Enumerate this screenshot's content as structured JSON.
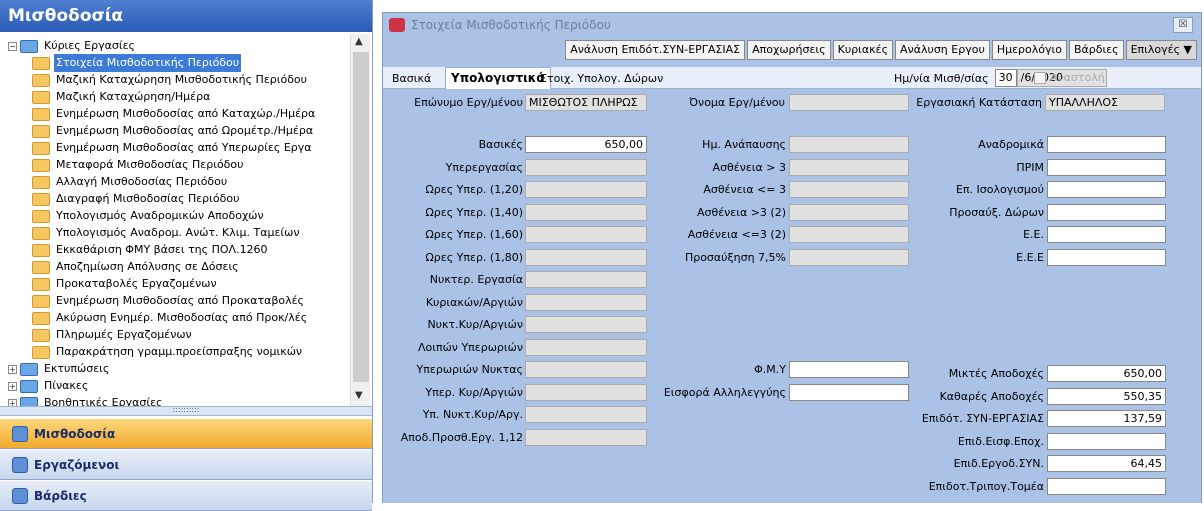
{
  "nav": {
    "title": "Μισθοδοσία",
    "tree": [
      {
        "label": "Κύριες Εργασίες",
        "level": 0,
        "expander": "−",
        "blue": true
      },
      {
        "label": "Στοιχεία Μισθοδοτικής Περιόδου",
        "level": 1,
        "selected": true
      },
      {
        "label": "Μαζική Καταχώρηση Μισθοδοτικής Περιόδου",
        "level": 1
      },
      {
        "label": "Μαζική Καταχώρηση/Ημέρα",
        "level": 1
      },
      {
        "label": "Ενημέρωση Μισθοδοσίας από Καταχώρ./Ημέρα",
        "level": 1
      },
      {
        "label": "Ενημέρωση Μισθοδοσίας από Ωρομέτρ./Ημέρα",
        "level": 1
      },
      {
        "label": "Ενημέρωση Μισθοδοσίας από Υπερωρίες Εργα",
        "level": 1
      },
      {
        "label": "Μεταφορά Μισθοδοσίας Περιόδου",
        "level": 1
      },
      {
        "label": "Αλλαγή Μισθοδοσίας Περιόδου",
        "level": 1
      },
      {
        "label": "Διαγραφή Μισθοδοσίας Περιόδου",
        "level": 1
      },
      {
        "label": "Υπολογισμός Αναδρομικών Αποδοχών",
        "level": 1
      },
      {
        "label": "Υπολογισμός Αναδρομ. Ανώτ. Κλιμ. Ταμείων",
        "level": 1
      },
      {
        "label": "Εκκαθάριση ΦΜΥ βάσει της ΠΟΛ.1260",
        "level": 1
      },
      {
        "label": "Αποζημίωση Απόλυσης σε Δόσεις",
        "level": 1
      },
      {
        "label": "Προκαταβολές Εργαζομένων",
        "level": 1
      },
      {
        "label": "Ενημέρωση Μισθοδοσίας από Προκαταβολές",
        "level": 1
      },
      {
        "label": "Ακύρωση Ενημέρ. Μισθοδοσίας από Προκ/λές",
        "level": 1
      },
      {
        "label": "Πληρωμές Εργαζομένων",
        "level": 1
      },
      {
        "label": "Παρακράτηση γραμμ.προείσπραξης νομικών",
        "level": 1
      },
      {
        "label": "Εκτυπώσεις",
        "level": 0,
        "expander": "+",
        "blue": true
      },
      {
        "label": "Πίνακες",
        "level": 0,
        "expander": "+",
        "blue": true
      },
      {
        "label": "Βοηθητικές Εργασίες",
        "level": 0,
        "expander": "+",
        "blue": true
      }
    ],
    "splitter_dots": "::::::::::",
    "buttons": [
      {
        "label": "Μισθοδοσία",
        "active": true
      },
      {
        "label": "Εργαζόμενοι",
        "active": false
      },
      {
        "label": "Βάρδιες",
        "active": false
      }
    ]
  },
  "window": {
    "title": "Στοιχεία Μισθοδοτικής Περιόδου",
    "close": "☒",
    "toolbar": [
      "Ανάλυση Επιδότ.ΣΥΝ-ΕΡΓΑΣΙΑΣ",
      "Αποχωρήσεις",
      "Κυριακές",
      "Ανάλυση Εργου",
      "Ημερολόγιο",
      "Βάρδιες",
      "Επιλογές ▼"
    ],
    "tabs": [
      "Βασικά",
      "Υπολογιστικά",
      "Στοιχ. Υπολογ. Δώρων"
    ],
    "active_tab": "Υπολογιστικά",
    "date_label": "Ημ/νία Μισθ/σίας",
    "date_day": "30",
    "date_rest": "/6/2020",
    "suspend_label": "Αναστολή"
  },
  "form": {
    "employee_label": "Επώνυμο Εργ/μένου",
    "employee_value": "ΜΙΣΘΩΤΟΣ ΠΛΗΡΩΣ",
    "first_name_label": "Όνομα Εργ/μένου",
    "first_name_value": "",
    "status_label": "Εργασιακή Κατάσταση",
    "status_value": "ΥΠΑΛΛΗΛΟΣ",
    "col1": [
      {
        "label": "Βασικές",
        "value": "650,00"
      },
      {
        "label": "Υπερεργασίας",
        "value": ""
      },
      {
        "label": "Ωρες Υπερ. (1,20)",
        "value": ""
      },
      {
        "label": "Ωρες Υπερ. (1,40)",
        "value": ""
      },
      {
        "label": "Ωρες Υπερ. (1,60)",
        "value": ""
      },
      {
        "label": "Ωρες Υπερ. (1,80)",
        "value": ""
      },
      {
        "label": "Νυκτερ. Εργασία",
        "value": ""
      },
      {
        "label": "Κυριακών/Αργιών",
        "value": ""
      },
      {
        "label": "Νυκτ.Κυρ/Αργιών",
        "value": ""
      },
      {
        "label": "Λοιπών Υπερωριών",
        "value": ""
      },
      {
        "label": "Υπερωριών Νυκτας",
        "value": ""
      },
      {
        "label": "Υπερ. Κυρ/Αργιών",
        "value": ""
      },
      {
        "label": "Υπ. Νυκτ.Κυρ/Αργ.",
        "value": ""
      },
      {
        "label": "Αποδ.Προσθ.Εργ. 1,12",
        "value": ""
      }
    ],
    "col2": [
      {
        "label": "Ημ. Ανάπαυσης",
        "value": ""
      },
      {
        "label": "Ασθένεια > 3",
        "value": ""
      },
      {
        "label": "Ασθένεια <= 3",
        "value": ""
      },
      {
        "label": "Ασθένεια >3 (2)",
        "value": ""
      },
      {
        "label": "Ασθένεια <=3 (2)",
        "value": ""
      },
      {
        "label": "Προσαύξηση 7,5%",
        "value": ""
      }
    ],
    "col2b": [
      {
        "label": "Φ.Μ.Υ",
        "value": ""
      },
      {
        "label": "Εισφορά Αλληλεγγύης",
        "value": ""
      }
    ],
    "col3": [
      {
        "label": "Αναδρομικά",
        "value": ""
      },
      {
        "label": "ΠΡΙΜ",
        "value": ""
      },
      {
        "label": "Επ. Ισολογισμού",
        "value": ""
      },
      {
        "label": "Προσαύξ. Δώρων",
        "value": ""
      },
      {
        "label": "Ε.Ε.",
        "value": ""
      },
      {
        "label": "Ε.Ε.Ε",
        "value": ""
      }
    ],
    "col3b": [
      {
        "label": "Μικτές Αποδοχές",
        "value": "650,00"
      },
      {
        "label": "Καθαρές Αποδοχές",
        "value": "550,35"
      },
      {
        "label": "Επιδότ. ΣΥΝ-ΕΡΓΑΣΙΑΣ",
        "value": "137,59"
      },
      {
        "label": "Επιδ.Εισφ.Εποχ.",
        "value": ""
      },
      {
        "label": "Επιδ.Εργοδ.ΣΥΝ.",
        "value": "64,45"
      },
      {
        "label": "Επιδοτ.Τριπογ.Τομέα",
        "value": ""
      }
    ]
  }
}
